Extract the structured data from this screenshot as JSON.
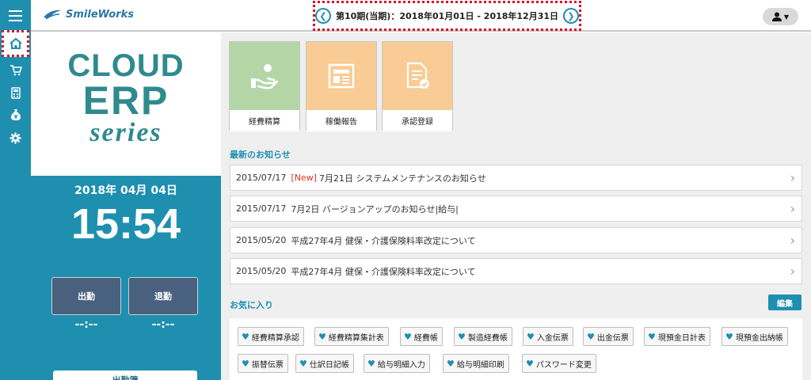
{
  "header": {
    "logo_text": "SmileWorks",
    "period_text": "第10期(当期)：2018年01月01日 - 2018年12月31日",
    "prev_icon": "chevron-left-icon",
    "next_icon": "chevron-right-icon",
    "user_icon": "user-icon"
  },
  "sidebar": {
    "items": [
      {
        "icon": "menu-icon"
      },
      {
        "icon": "home-icon"
      },
      {
        "icon": "cart-icon"
      },
      {
        "icon": "calculator-icon"
      },
      {
        "icon": "money-bag-icon"
      },
      {
        "icon": "gear-icon"
      }
    ]
  },
  "brand": {
    "line1": "CLOUD",
    "line2": "ERP",
    "line3": "series"
  },
  "clock": {
    "date": "2018年 04月 04日",
    "time": "15:54",
    "clock_in_label": "出勤",
    "clock_out_label": "退勤",
    "clock_in_time": "--:--",
    "clock_out_time": "--:--",
    "bottom_button": "出勤簿"
  },
  "tiles": [
    {
      "label": "経費精算",
      "icon": "expense-hand-icon",
      "color": "#b4d6a7"
    },
    {
      "label": "稼働報告",
      "icon": "report-icon",
      "color": "#f8cc94"
    },
    {
      "label": "承認登録",
      "icon": "approval-doc-icon",
      "color": "#f8cc94"
    }
  ],
  "news": {
    "title": "最新のお知らせ",
    "items": [
      {
        "date": "2015/07/17",
        "tag": "[New]",
        "title": "7月21日 システムメンテナンスのお知らせ"
      },
      {
        "date": "2015/07/17",
        "tag": "",
        "title": "7月2日 バージョンアップのお知らせ|給与|"
      },
      {
        "date": "2015/05/20",
        "tag": "",
        "title": "平成27年4月 健保・介護保険料率改定について"
      },
      {
        "date": "2015/05/20",
        "tag": "",
        "title": "平成27年4月 健保・介護保険料率改定について"
      }
    ]
  },
  "favorites": {
    "title": "お気に入り",
    "edit_label": "編集",
    "items": [
      "経費精算承認",
      "経費精算集計表",
      "経費帳",
      "製造経費帳",
      "入金伝票",
      "出金伝票",
      "現預金日計表",
      "現預金出納帳",
      "振替伝票",
      "仕訳日記帳",
      "給与明細入力",
      "給与明細印刷",
      "パスワード変更"
    ]
  },
  "colors": {
    "accent": "#1f8fb0",
    "punch": "#49617e",
    "highlight": "#d8102a",
    "new_tag": "#e03020"
  }
}
